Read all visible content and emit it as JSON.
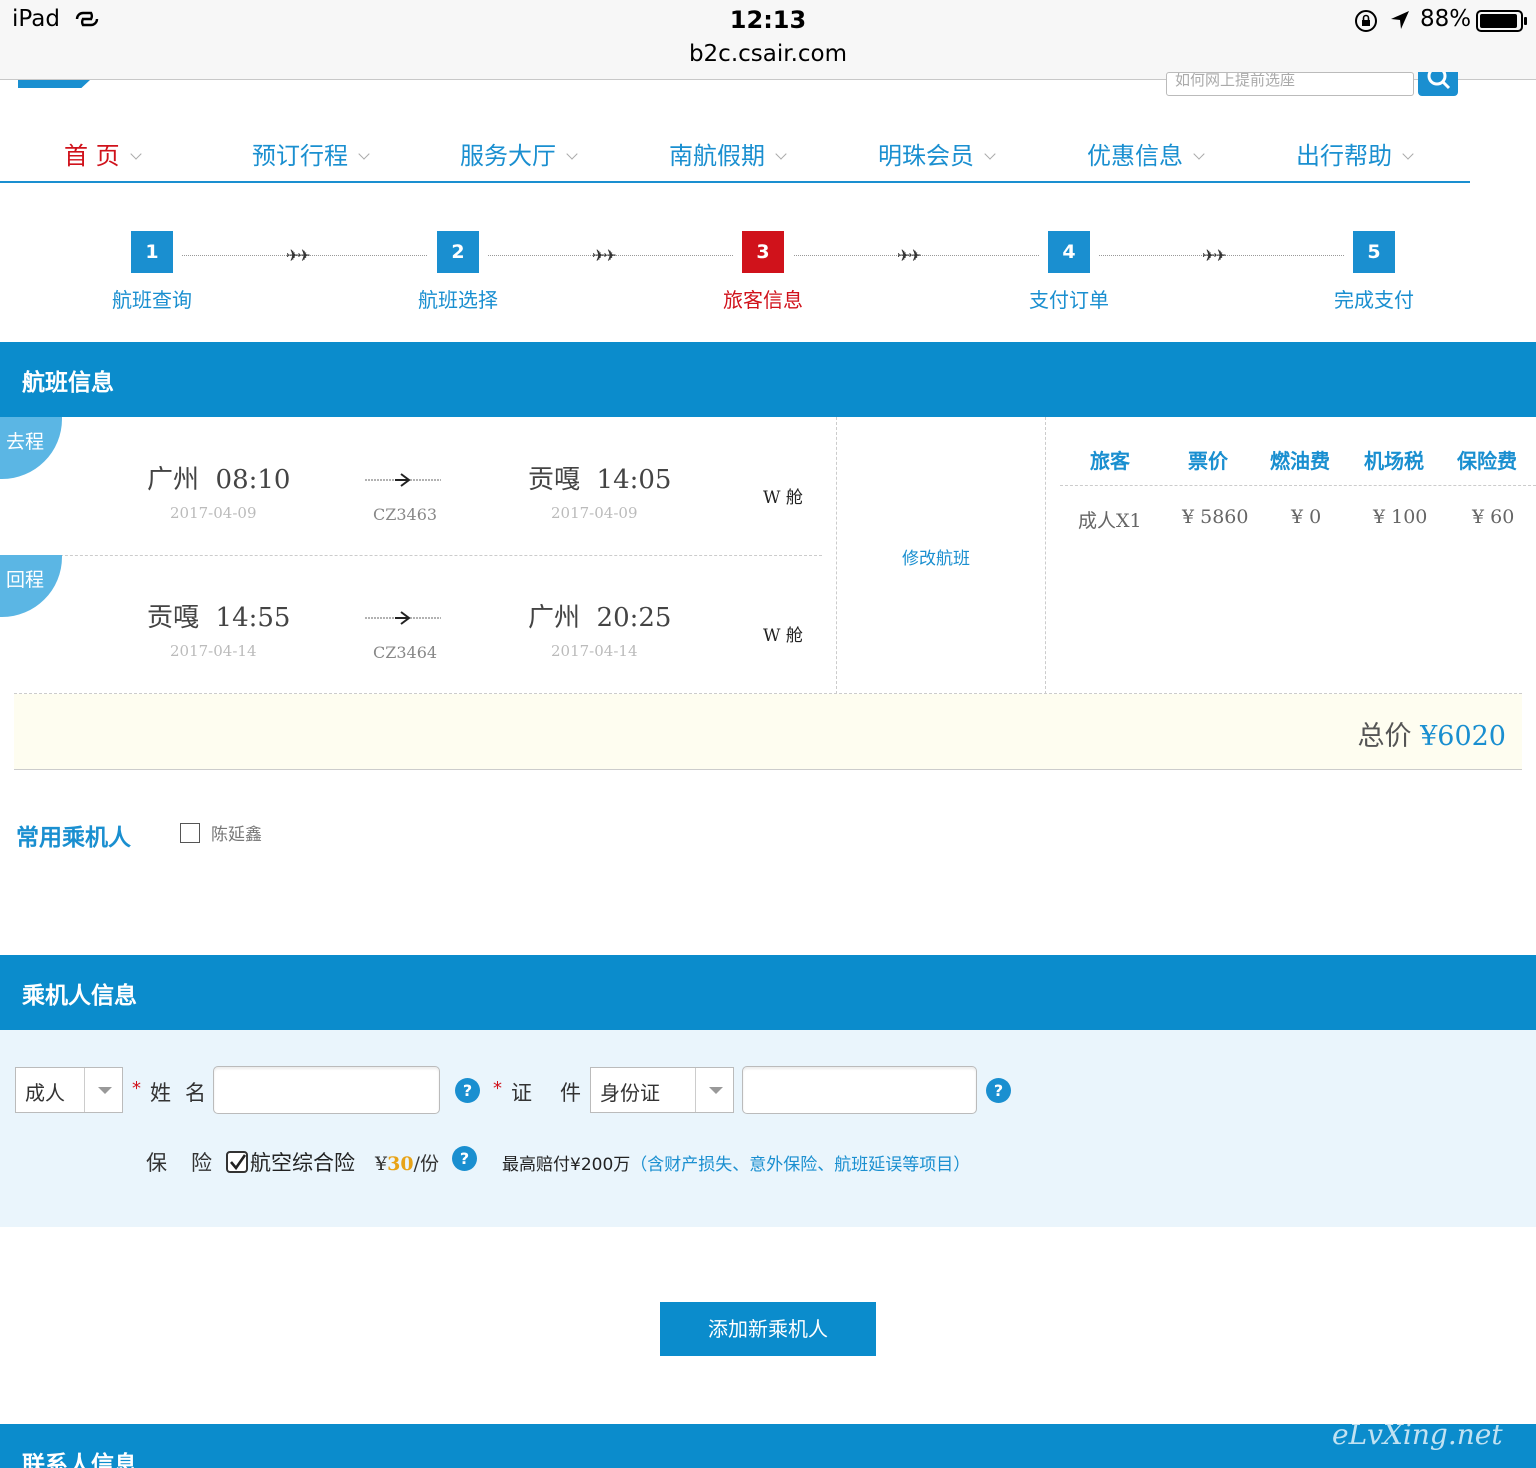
{
  "status_bar": {
    "device": "iPad",
    "time": "12:13",
    "url": "b2c.csair.com",
    "battery": "88%"
  },
  "header": {
    "search_placeholder": "如何网上提前选座"
  },
  "nav": {
    "items": [
      {
        "label": "首 页"
      },
      {
        "label": "预订行程"
      },
      {
        "label": "服务大厅"
      },
      {
        "label": "南航假期"
      },
      {
        "label": "明珠会员"
      },
      {
        "label": "优惠信息"
      },
      {
        "label": "出行帮助"
      }
    ]
  },
  "steps": [
    {
      "num": "1",
      "label": "航班查询"
    },
    {
      "num": "2",
      "label": "航班选择"
    },
    {
      "num": "3",
      "label": "旅客信息"
    },
    {
      "num": "4",
      "label": "支付订单"
    },
    {
      "num": "5",
      "label": "完成支付"
    }
  ],
  "flight_info": {
    "title": "航班信息",
    "segments": [
      {
        "badge": "去程",
        "from_city": "广州",
        "dep_time": "08:10",
        "dep_date": "2017-04-09",
        "flight_no": "CZ3463",
        "to_city": "贡嘎",
        "arr_time": "14:05",
        "arr_date": "2017-04-09",
        "cabin": "W 舱"
      },
      {
        "badge": "回程",
        "from_city": "贡嘎",
        "dep_time": "14:55",
        "dep_date": "2017-04-14",
        "flight_no": "CZ3464",
        "to_city": "广州",
        "arr_time": "20:25",
        "arr_date": "2017-04-14",
        "cabin": "W 舱"
      }
    ],
    "modify_link": "修改航班",
    "price_headers": [
      "旅客",
      "票价",
      "燃油费",
      "机场税",
      "保险费"
    ],
    "price_row": [
      "成人X1",
      "¥ 5860",
      "¥ 0",
      "¥ 100",
      "¥ 60"
    ],
    "total_label": "总价",
    "total_amount": "¥6020"
  },
  "frequent": {
    "title": "常用乘机人",
    "names": [
      "陈延鑫"
    ]
  },
  "passenger": {
    "title": "乘机人信息",
    "type_value": "成人",
    "name_label": "姓名",
    "id_label": "证件",
    "id_type_value": "身份证",
    "name_value": "",
    "id_value": "",
    "insurance_label": "保险",
    "insurance_name": "航空综合险",
    "insurance_price_prefix": "¥",
    "insurance_price": "30",
    "insurance_price_suffix": "/份",
    "insurance_desc": "最高赔付¥200万",
    "insurance_desc_extra": "（含财产损失、意外保险、航班延误等项目）",
    "add_button": "添加新乘机人"
  },
  "contact": {
    "title": "联系人信息"
  },
  "watermark": "eLvXing.net"
}
